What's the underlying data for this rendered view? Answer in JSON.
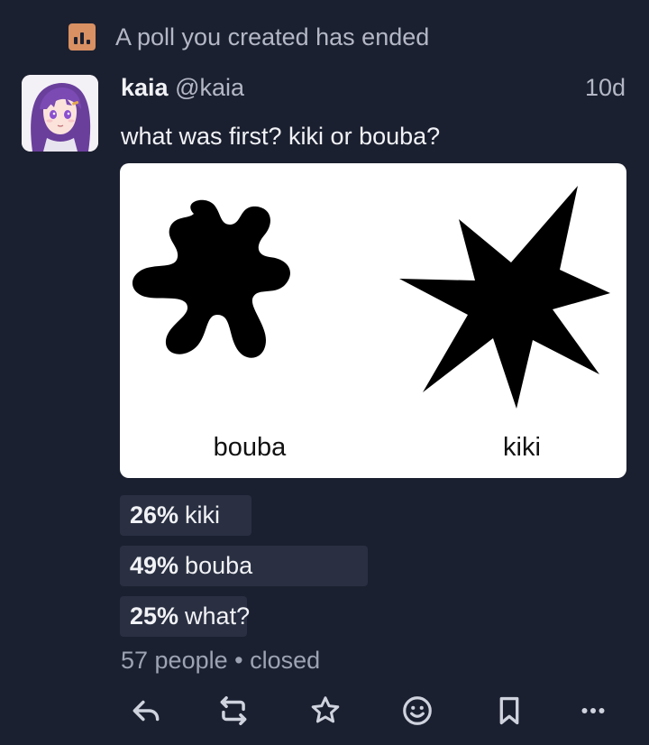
{
  "notification": {
    "icon": "poll-icon",
    "text": "A poll you created has ended",
    "icon_color": "#d99062"
  },
  "status": {
    "author": {
      "display_name": "kaia",
      "handle": "@kaia",
      "avatar": "anime-girl-purple-hair-avatar"
    },
    "time": "10d",
    "text": "what was first? kiki or bouba?",
    "media": {
      "left_label": "bouba",
      "right_label": "kiki"
    },
    "poll": {
      "options": [
        {
          "percent": "26%",
          "label": "kiki",
          "fraction": 0.26
        },
        {
          "percent": "49%",
          "label": "bouba",
          "fraction": 0.49
        },
        {
          "percent": "25%",
          "label": "what?",
          "fraction": 0.25
        }
      ],
      "footer": "57 people • closed"
    },
    "actions": [
      "reply-icon",
      "boost-icon",
      "favourite-icon",
      "emoji-react-icon",
      "bookmark-icon",
      "more-icon"
    ]
  },
  "colors": {
    "background": "#1b2030",
    "bar": "#2a3042",
    "muted_text": "#b4b8c6",
    "icon": "#cfd3de"
  }
}
